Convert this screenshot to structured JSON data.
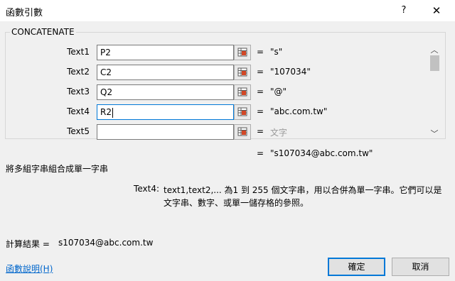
{
  "window": {
    "title": "函數引數",
    "help_label": "?",
    "close_label": "✕"
  },
  "function": {
    "name": "CONCATENATE",
    "args": [
      {
        "label": "Text1",
        "input": "P2",
        "result": "\"s\"",
        "hint": false
      },
      {
        "label": "Text2",
        "input": "C2",
        "result": "\"107034\"",
        "hint": false
      },
      {
        "label": "Text3",
        "input": "Q2",
        "result": "\"@\"",
        "hint": false
      },
      {
        "label": "Text4",
        "input": "R2",
        "result": "\"abc.com.tw\"",
        "hint": false
      },
      {
        "label": "Text5",
        "input": "",
        "result": "文字",
        "hint": true
      }
    ],
    "eq_sign": "=",
    "result": "\"s107034@abc.com.tw\"",
    "description": "將多組字串組合成單一字串",
    "arg_desc_label": "Text4:",
    "arg_desc_text": "text1,text2,... 為1 到 255 個文字串，用以合併為單一字串。它們可以是文字串、數字、或單一儲存格的參照。"
  },
  "footer": {
    "calc_label": "計算結果 =",
    "calc_value": "s107034@abc.com.tw",
    "help_link": "函數說明(H)",
    "ok_label": "確定",
    "cancel_label": "取消"
  },
  "colors": {
    "accent": "#0078d7",
    "link": "#0066cc"
  }
}
